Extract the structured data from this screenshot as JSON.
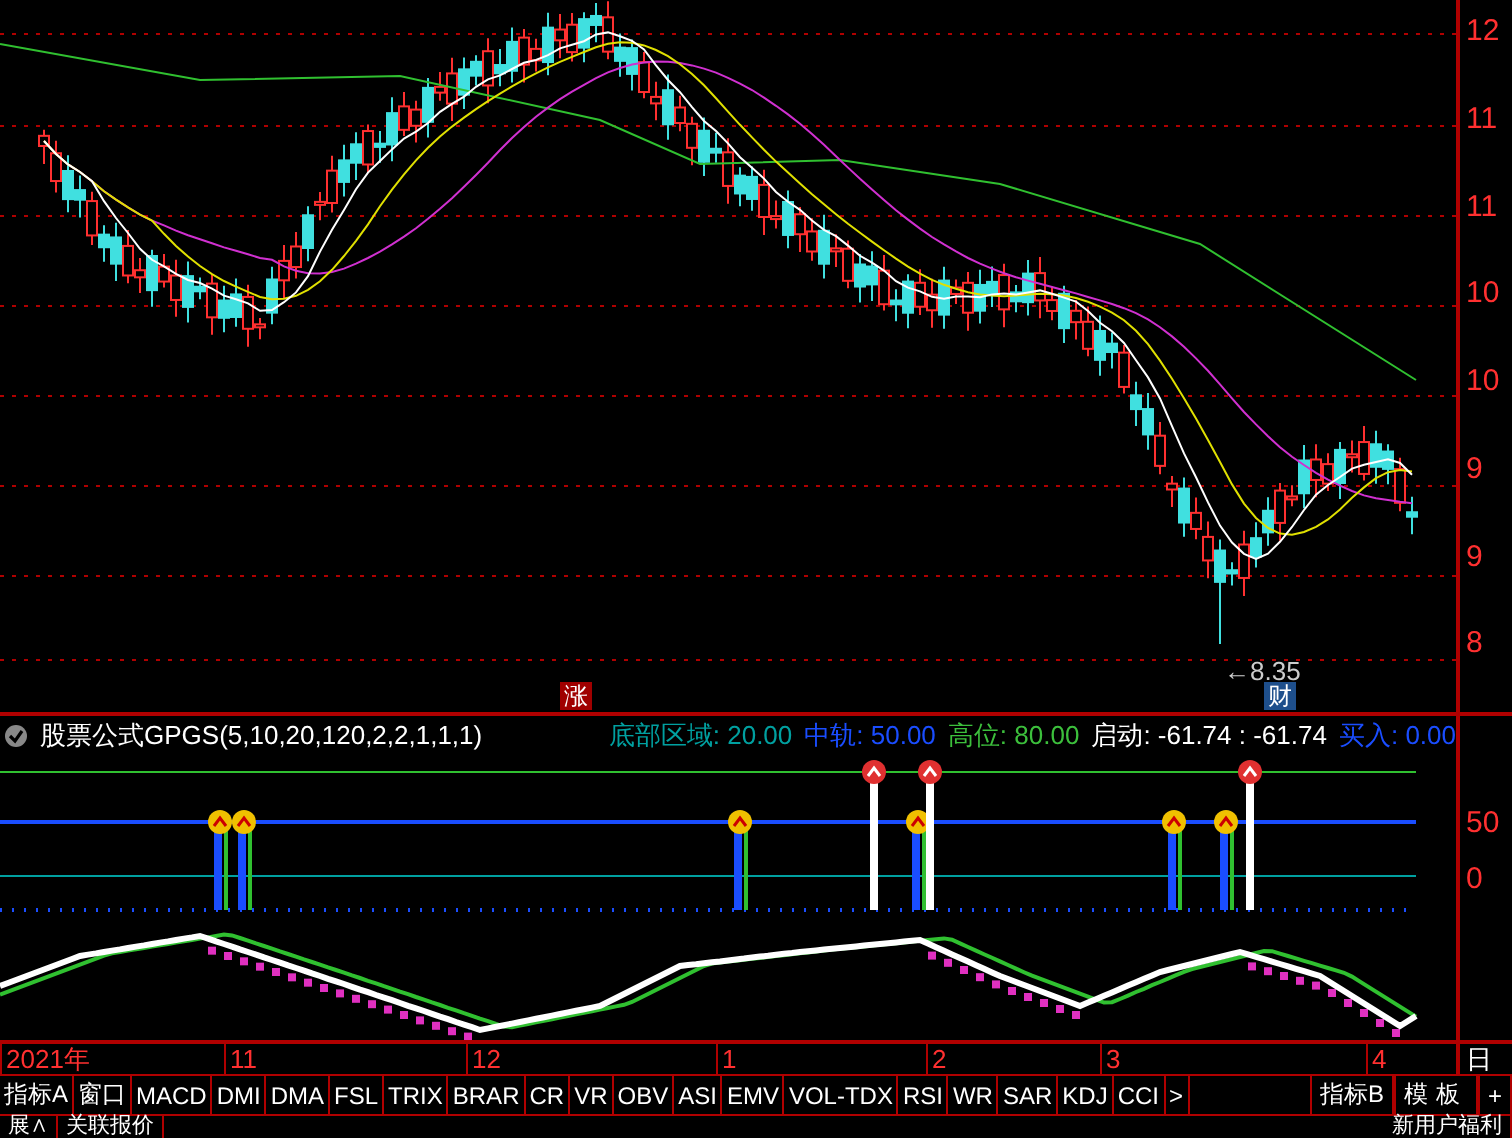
{
  "price_axis": {
    "labels": [
      "12",
      "11",
      "11",
      "10",
      "10",
      "9",
      "9",
      "8"
    ]
  },
  "chart_markers": [
    {
      "kind": "rise",
      "text": "涨"
    },
    {
      "kind": "finance",
      "text": "财"
    }
  ],
  "low_label": "←8.35",
  "indicator": {
    "title": "股票公式GPGS(5,10,20,120,2,2,1,1,1)",
    "values": [
      {
        "label": "底部区域: 20.00",
        "color": "#00a0a0"
      },
      {
        "label": "中轨: 50.00",
        "color": "#1a4dff"
      },
      {
        "label": "高位: 80.00",
        "color": "#3cbf3c"
      },
      {
        "label": "启动: -61.74 : -61.74",
        "color": "#ffffff"
      },
      {
        "label": "买入: 0.00",
        "color": "#1a4dff"
      }
    ],
    "axis_labels": [
      "50",
      "0"
    ]
  },
  "time_axis": {
    "labels": [
      "2021年",
      "11",
      "12",
      "1",
      "2",
      "3",
      "4"
    ],
    "period": "日"
  },
  "tabs": [
    {
      "label": "指标A",
      "selected": false
    },
    {
      "label": "窗口",
      "selected": false
    },
    {
      "label": "MACD",
      "selected": false
    },
    {
      "label": "DMI",
      "selected": false
    },
    {
      "label": "DMA",
      "selected": false
    },
    {
      "label": "FSL",
      "selected": false
    },
    {
      "label": "TRIX",
      "selected": false
    },
    {
      "label": "BRAR",
      "selected": false
    },
    {
      "label": "CR",
      "selected": false
    },
    {
      "label": "VR",
      "selected": false
    },
    {
      "label": "OBV",
      "selected": false
    },
    {
      "label": "ASI",
      "selected": false
    },
    {
      "label": "EMV",
      "selected": false
    },
    {
      "label": "VOL-TDX",
      "selected": false
    },
    {
      "label": "RSI",
      "selected": false
    },
    {
      "label": "WR",
      "selected": false
    },
    {
      "label": "SAR",
      "selected": false
    },
    {
      "label": "KDJ",
      "selected": false
    },
    {
      "label": "CCI",
      "selected": false
    },
    {
      "label": ">",
      "selected": false
    }
  ],
  "right_tabs": [
    {
      "label": "指标B",
      "selected": false
    },
    {
      "label": "模板",
      "selected": false
    },
    {
      "label": "+",
      "selected": false
    }
  ],
  "bottom_bar": {
    "left": [
      "展∧",
      "关联报价"
    ],
    "right": "新用户福利"
  }
}
